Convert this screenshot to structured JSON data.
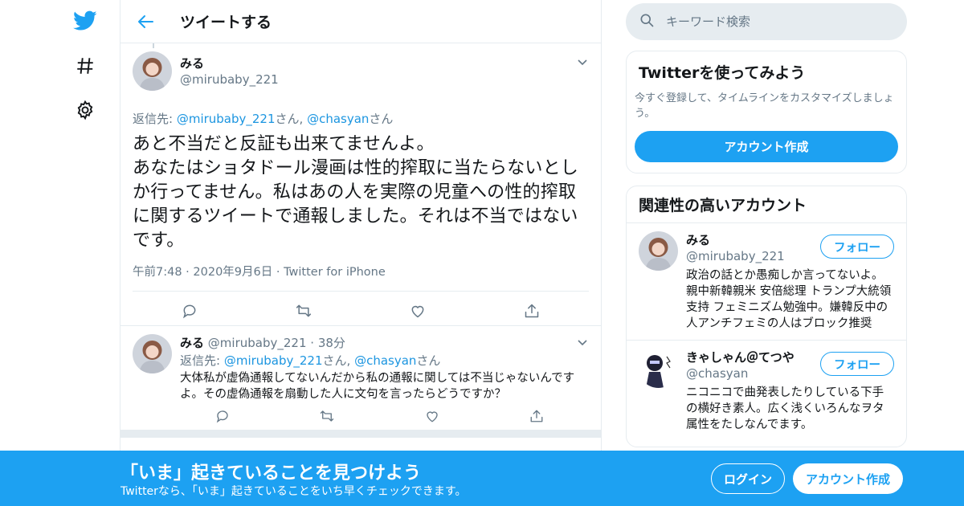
{
  "app": {
    "accent": "#1da1f2",
    "border": "#e6ecf0",
    "muted": "#657786"
  },
  "nav": {
    "icons": [
      "twitter-bird-icon",
      "hashtag-icon",
      "gear-icon"
    ]
  },
  "header": {
    "title": "ツイートする"
  },
  "focus_tweet": {
    "name": "みる",
    "handle": "@mirubaby_221",
    "reply_prefix": "返信先: ",
    "reply_user1": "@mirubaby_221",
    "reply_mid": "さん, ",
    "reply_user2": "@chasyan",
    "reply_suffix": "さん",
    "text": "あと不当だと反証も出来てませんよ。\nあなたはショタドール漫画は性的搾取に当たらないとしか行ってません。私はあの人を実際の児童への性的搾取に関するツイートで通報しました。それは不当ではないです。",
    "time": "午前7:48",
    "date": "2020年9月6日",
    "client": "Twitter for iPhone"
  },
  "reply_tweet": {
    "name": "みる",
    "handle": "@mirubaby_221",
    "age": "38分",
    "reply_prefix": "返信先: ",
    "reply_user1": "@mirubaby_221",
    "reply_mid": "さん, ",
    "reply_user2": "@chasyan",
    "reply_suffix": "さん",
    "text": "大体私が虚偽通報してないんだから私の通報に関しては不当じゃないんですよ。その虚偽通報を扇動した人に文句を言ったらどうですか？"
  },
  "search": {
    "placeholder": "キーワード検索"
  },
  "signup_card": {
    "title": "Twitterを使ってみよう",
    "desc": "今すぐ登録して、タイムラインをカスタマイズしましょう。",
    "button": "アカウント作成"
  },
  "related": {
    "title": "関連性の高いアカウント",
    "users": [
      {
        "name": "みる",
        "handle": "@mirubaby_221",
        "follow": "フォロー",
        "bio": "政治の話とか愚痴しか言ってないよ。親中新韓親米 安倍総理 トランプ大統領 支持 フェミニズム勉強中。嫌韓反中の人アンチフェミの人はブロック推奨"
      },
      {
        "name": "きゃしゃん＠てつや",
        "handle": "@chasyan",
        "follow": "フォロー",
        "bio": "ニコニコで曲発表したりしている下手の横好き素人。広く浅くいろんなヲタ属性をたしなんでます。"
      }
    ]
  },
  "banner": {
    "title": "「いま」起きていることを見つけよう",
    "subtitle": "Twitterなら、「いま」起きていることをいち早くチェックできます。",
    "login": "ログイン",
    "signup": "アカウント作成"
  }
}
